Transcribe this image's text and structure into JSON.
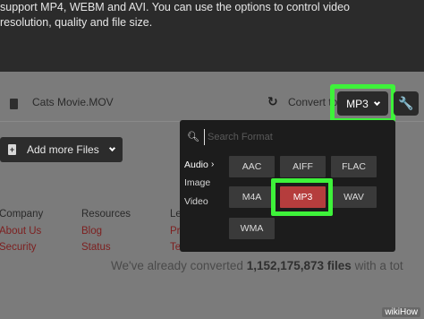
{
  "intro": {
    "line1": "support MP4, WEBM and AVI. You can use the options to control video",
    "line2": "resolution, quality and file size."
  },
  "file": {
    "name": "Cats Movie.MOV",
    "convert_label": "Convert to",
    "format_value": "MP3",
    "icons": [
      "file-icon",
      "refresh-icon",
      "wrench-icon"
    ]
  },
  "add_files": {
    "label": "Add more Files"
  },
  "dropdown": {
    "search_placeholder": "Search Format",
    "categories": [
      "Audio",
      "Image",
      "Video"
    ],
    "active_category": "Audio",
    "formats": [
      "AAC",
      "AIFF",
      "FLAC",
      "M4A",
      "MP3",
      "WAV",
      "WMA"
    ],
    "selected_format": "MP3"
  },
  "footer": {
    "company_heading": "Company",
    "company_links": [
      "About Us",
      "Security"
    ],
    "resources_heading": "Resources",
    "resources_links": [
      "Blog",
      "Status"
    ],
    "legal_heading": "Le",
    "legal_links": [
      "Pr",
      "Te"
    ]
  },
  "stats": {
    "prefix": "We've already converted",
    "count": "1,152,175,873",
    "suffix_bold": "files",
    "suffix": "with a tot"
  },
  "watermark": "wikiHow",
  "colors": {
    "highlight": "#3ef23a",
    "selected": "#b53d3d",
    "link": "#7d1f1f"
  }
}
